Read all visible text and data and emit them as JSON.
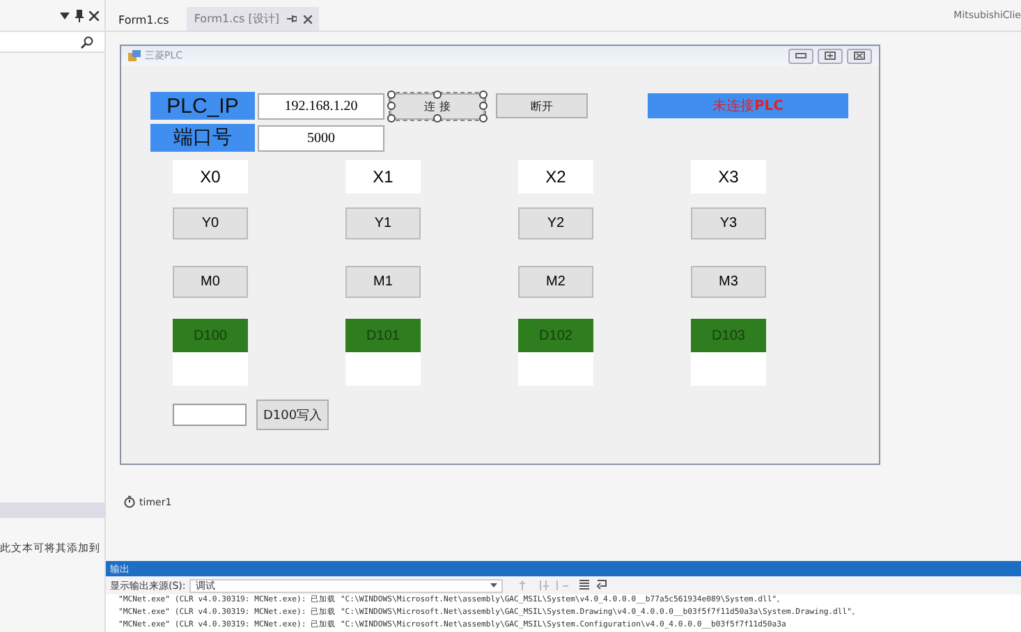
{
  "left_panel": {
    "hint": "此文本可将其添加到"
  },
  "tabs": [
    {
      "label": "Form1.cs",
      "selected": false
    },
    {
      "label": "Form1.cs [设计]",
      "selected": true
    }
  ],
  "project_name": "MitsubishiClie",
  "form": {
    "title": "三菱PLC",
    "ip_label": "PLC_IP",
    "ip_value": "192.168.1.20",
    "port_label": "端口号",
    "port_value": "5000",
    "connect_button": {
      "label": "连 接",
      "selected": true
    },
    "disconnect_button": {
      "label": "断开",
      "selected": false
    },
    "status": "未连接**PLC**",
    "columns": [
      {
        "x": "X0",
        "y": "Y0",
        "m": "M0",
        "d": "D100"
      },
      {
        "x": "X1",
        "y": "Y1",
        "m": "M1",
        "d": "D101"
      },
      {
        "x": "X2",
        "y": "Y2",
        "m": "M2",
        "d": "D102"
      },
      {
        "x": "X3",
        "y": "Y3",
        "m": "M3",
        "d": "D103"
      }
    ],
    "write_button": "D100写入"
  },
  "tray": [
    {
      "label": "timer1"
    }
  ],
  "output": {
    "title": "输出",
    "source_label": "显示输出来源(S):",
    "source": "调试",
    "lines": [
      "\"MCNet.exe\" (CLR v4.0.30319: MCNet.exe): 已加载 \"C:\\WINDOWS\\Microsoft.Net\\assembly\\GAC_MSIL\\System\\v4.0_4.0.0.0__b77a5c561934e089\\System.dll\"。",
      "\"MCNet.exe\" (CLR v4.0.30319: MCNet.exe): 已加载 \"C:\\WINDOWS\\Microsoft.Net\\assembly\\GAC_MSIL\\System.Drawing\\v4.0_4.0.0.0__b03f5f7f11d50a3a\\System.Drawing.dll\"。",
      "\"MCNet.exe\" (CLR v4.0.30319: MCNet.exe): 已加载 \"C:\\WINDOWS\\Microsoft.Net\\assembly\\GAC_MSIL\\System.Configuration\\v4.0_4.0.0.0__b03f5f7f11d50a3a"
    ]
  }
}
